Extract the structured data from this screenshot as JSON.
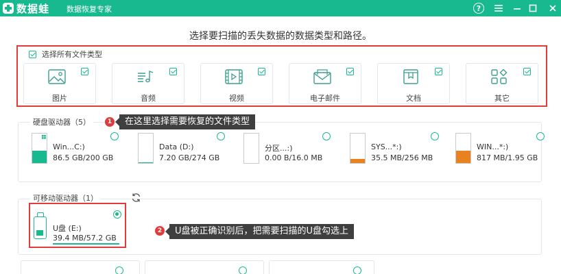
{
  "app": {
    "logo": "数据蛙",
    "subtitle": "数据恢复专家"
  },
  "window_buttons": {
    "help": "?"
  },
  "prompt": "选择要扫描的丢失数据的数据类型和路径。",
  "file_types": {
    "select_all_label": "选择所有文件类型",
    "items": [
      {
        "label": "图片",
        "icon": "image-icon",
        "checked": true
      },
      {
        "label": "音频",
        "icon": "audio-icon",
        "checked": true
      },
      {
        "label": "视频",
        "icon": "video-icon",
        "checked": true
      },
      {
        "label": "电子邮件",
        "icon": "email-icon",
        "checked": true
      },
      {
        "label": "文档",
        "icon": "document-icon",
        "checked": true
      },
      {
        "label": "其它",
        "icon": "other-icon",
        "checked": true
      }
    ]
  },
  "hard_drives": {
    "label": "硬盘驱动器（5）",
    "items": [
      {
        "name": "Win...C:)",
        "size": "86.5 GB/200 GB",
        "used_fraction": 0.43,
        "color": "#18b98e",
        "os_logo": true
      },
      {
        "name": "Data (D:)",
        "size": "7.20 GB/274 GB",
        "used_fraction": 0.03,
        "color": "#18b98e",
        "os_logo": false
      },
      {
        "name": "分区...:)",
        "size": "0.00 B/16.0 MB",
        "used_fraction": 0.0,
        "color": "#e8821e",
        "os_logo": false
      },
      {
        "name": "SYS...*:)",
        "size": "35.5 MB/256 MB",
        "used_fraction": 0.14,
        "color": "#e8821e",
        "os_logo": false
      },
      {
        "name": "WIN...*:)",
        "size": "817 MB/1.95 GB",
        "used_fraction": 0.41,
        "color": "#e8821e",
        "os_logo": false
      }
    ]
  },
  "removable_drives": {
    "label": "可移动驱动器（1）",
    "items": [
      {
        "name": "U盘 (E:)",
        "size": "39.4 MB/57.2 GB",
        "selected": true
      }
    ]
  },
  "annotations": [
    {
      "number": "1",
      "text": "在这里选择需要恢复的文件类型"
    },
    {
      "number": "2",
      "text": "U盘被正确识别后，把需要扫描的U盘勾选上"
    }
  ],
  "colors": {
    "accent": "#18b98e",
    "highlight": "#e13b3b",
    "tooltip": "#3f3f3f",
    "orange": "#e8821e"
  }
}
